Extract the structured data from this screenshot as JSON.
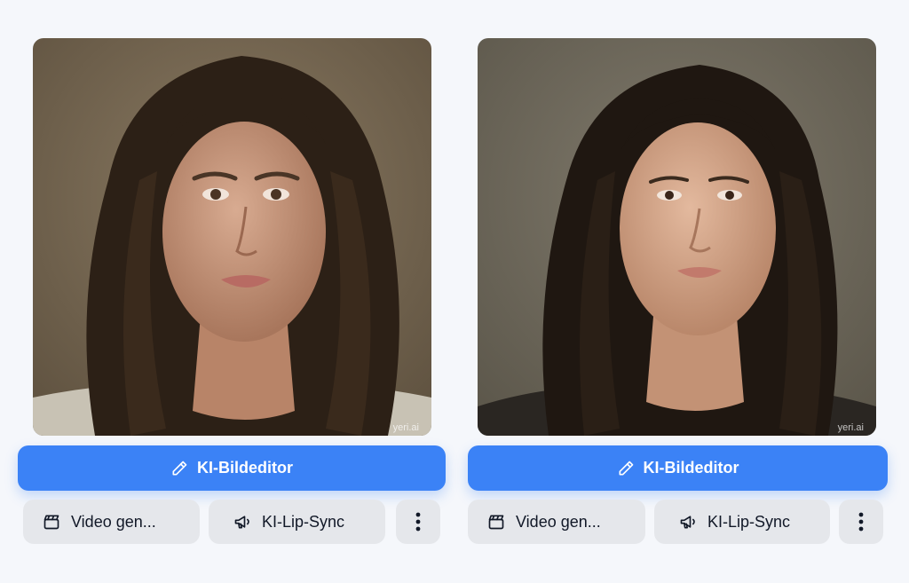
{
  "cards": [
    {
      "watermark": "yeri.ai",
      "editor_label": "KI-Bildeditor",
      "video_label": "Video gen...",
      "lipsync_label": "KI-Lip-Sync",
      "photo_alt": "Portrait of a woman with long dark wavy hair"
    },
    {
      "watermark": "yeri.ai",
      "editor_label": "KI-Bildeditor",
      "video_label": "Video gen...",
      "lipsync_label": "KI-Lip-Sync",
      "photo_alt": "Portrait of a woman with long straight dark hair"
    }
  ],
  "colors": {
    "accent": "#3b82f6",
    "chip_bg": "#e5e7eb",
    "page_bg": "#f5f7fb"
  },
  "icons": [
    "pencil-icon",
    "clapperboard-icon",
    "megaphone-icon",
    "more-vertical-icon"
  ]
}
